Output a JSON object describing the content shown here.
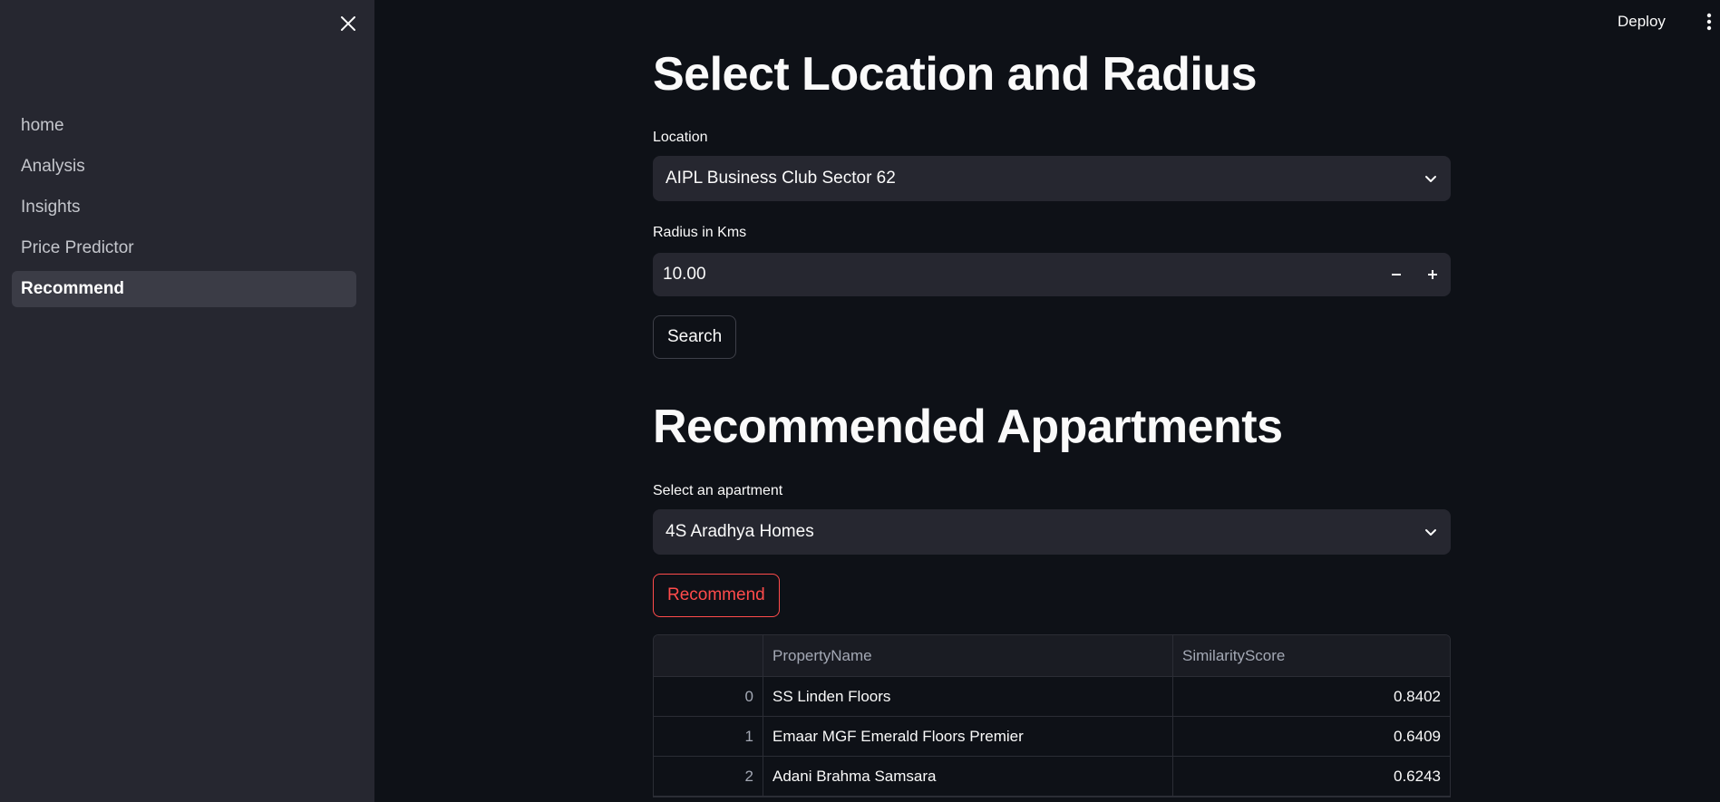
{
  "sidebar": {
    "items": [
      {
        "label": "home",
        "active": false
      },
      {
        "label": "Analysis",
        "active": false
      },
      {
        "label": "Insights",
        "active": false
      },
      {
        "label": "Price Predictor",
        "active": false
      },
      {
        "label": "Recommend",
        "active": true
      }
    ]
  },
  "header": {
    "deploy_label": "Deploy"
  },
  "main": {
    "title_location": "Select Location and Radius",
    "location_label": "Location",
    "location_value": "AIPL Business Club Sector 62",
    "radius_label": "Radius in Kms",
    "radius_value": "10.00",
    "search_label": "Search",
    "title_recommended": "Recommended Appartments",
    "apartment_label": "Select an apartment",
    "apartment_value": "4S Aradhya Homes",
    "recommend_label": "Recommend",
    "table": {
      "columns": [
        "",
        "PropertyName",
        "SimilarityScore"
      ],
      "rows": [
        {
          "index": "0",
          "name": "SS Linden Floors",
          "score": "0.8402"
        },
        {
          "index": "1",
          "name": "Emaar MGF Emerald Floors Premier",
          "score": "0.6409"
        },
        {
          "index": "2",
          "name": "Adani Brahma Samsara",
          "score": "0.6243"
        }
      ]
    }
  },
  "colors": {
    "background": "#0e1117",
    "sidebar": "#262730",
    "accent": "#ff4b4b"
  },
  "icons": {
    "sidebar_close": "close-icon",
    "menu": "kebab-menu-icon",
    "dropdown": "chevron-down-icon"
  }
}
